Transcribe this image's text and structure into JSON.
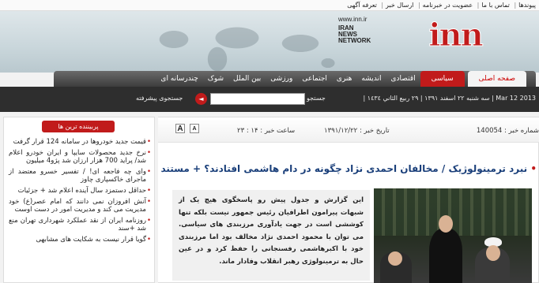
{
  "top_links": [
    "پیوندها",
    "تماس با ما",
    "عضویت در خبرنامه",
    "ارسال خبر",
    "تعرفه آگهی"
  ],
  "logo": {
    "url": "www.inn.ir",
    "line1": "IRAN",
    "line2": "NEWS",
    "line3": "NETWORK",
    "mark": "inn"
  },
  "nav": [
    {
      "label": "صفحه اصلی",
      "state": "home"
    },
    {
      "label": "سیاسی",
      "state": "active"
    },
    {
      "label": "اقتصادی",
      "state": ""
    },
    {
      "label": "اندیشه",
      "state": ""
    },
    {
      "label": "هنری",
      "state": ""
    },
    {
      "label": "اجتماعی",
      "state": ""
    },
    {
      "label": "ورزشی",
      "state": ""
    },
    {
      "label": "بین الملل",
      "state": ""
    },
    {
      "label": "شوک",
      "state": ""
    },
    {
      "label": "چندرسانه ای",
      "state": ""
    }
  ],
  "subbar": {
    "date_text": "Mar 12 2013 | سه شنبه ۲۲ اسفند ۱۳۹۱ | ۲۹ ربيع الثاني ۱٤٣٤ |",
    "search_label": "جستجو",
    "search_value": "",
    "search_arrow": "◄",
    "advanced_search": "جستجوی پیشرفته"
  },
  "sidebar": {
    "tab": "پربیننده ترین ها",
    "items": [
      "قیمت جدید خودروها در سامانه 124 قرار گرفت",
      "نرخ جدید محصولات سایپا و ایران خودرو اعلام شد/ پراید 700 هزار ارزان شد پژو4 میلیون",
      "وای چه فاجعه ای! / تفسیر خسرو معتضد از ماجرای خاکسپاری چاوز",
      "حداقل دستمزد سال آینده اعلام شد + جزئیات",
      "آنش افروزان نمی دانند که امام عصر(ع) خود مدیریت می کند و مدیریت امور در دست اوست",
      "روزنامه ایران از نقد عملکرد شهرداری تهران منع شد +سند",
      "گویا قرار نیست به شکایت های مشابهی"
    ]
  },
  "article": {
    "news_code_label": "شماره خبر :",
    "news_code": "140054",
    "date_label": "تاریخ خبر :",
    "date_value": "۱۳۹۱/۱۲/۲۲",
    "time_label": "ساعت خبر :",
    "time_value": "۱۴ : ۲۳",
    "font_large": "A",
    "font_small": "A",
    "headline": "نبرد ترمینولوژیک / مخالفان احمدی نژاد چگونه در دام هاشمی افتادند؟ + مستندات",
    "lead": "این گزارش و جدول پیش رو پاسخگوی هیچ یک از شبهات پیرامون اطرافیان رئیس جمهور نیست بلکه تنها کوششی است در جهت یادآوری مرزبندی های سیاسی. می توان با محمود احمدی نژاد مخالف بود اما مرزبندی خود با اکبرهاشمی رفسنجانی را حفظ کرد و در عین حال به ترمینولوژی رهبر انقلاب وفادار ماند."
  },
  "colors": {
    "accent": "#c11b1b",
    "headline": "#1a3f7a",
    "bar": "#2e2e2e"
  }
}
